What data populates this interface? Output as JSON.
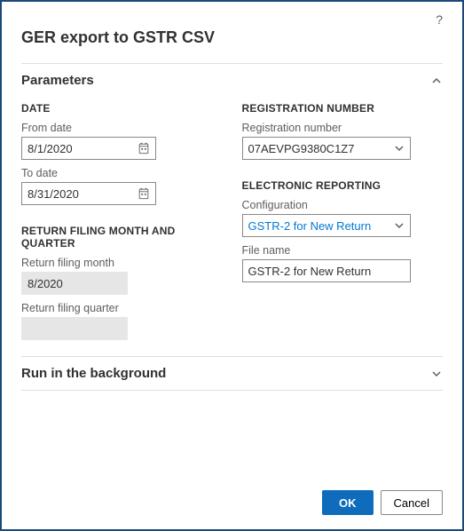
{
  "title": "GER export to GSTR CSV",
  "sections": {
    "parameters": {
      "label": "Parameters"
    },
    "run_bg": {
      "label": "Run in the background"
    }
  },
  "left": {
    "date_group": "DATE",
    "from_label": "From date",
    "from_value": "8/1/2020",
    "to_label": "To date",
    "to_value": "8/31/2020",
    "return_group": "RETURN FILING MONTH AND QUARTER",
    "month_label": "Return filing month",
    "month_value": "8/2020",
    "quarter_label": "Return filing quarter",
    "quarter_value": ""
  },
  "right": {
    "reg_group": "REGISTRATION NUMBER",
    "reg_label": "Registration number",
    "reg_value": "07AEVPG9380C1Z7",
    "er_group": "ELECTRONIC REPORTING",
    "config_label": "Configuration",
    "config_value": "GSTR-2 for New Return",
    "file_label": "File name",
    "file_value": "GSTR-2 for New Return"
  },
  "footer": {
    "ok": "OK",
    "cancel": "Cancel"
  }
}
